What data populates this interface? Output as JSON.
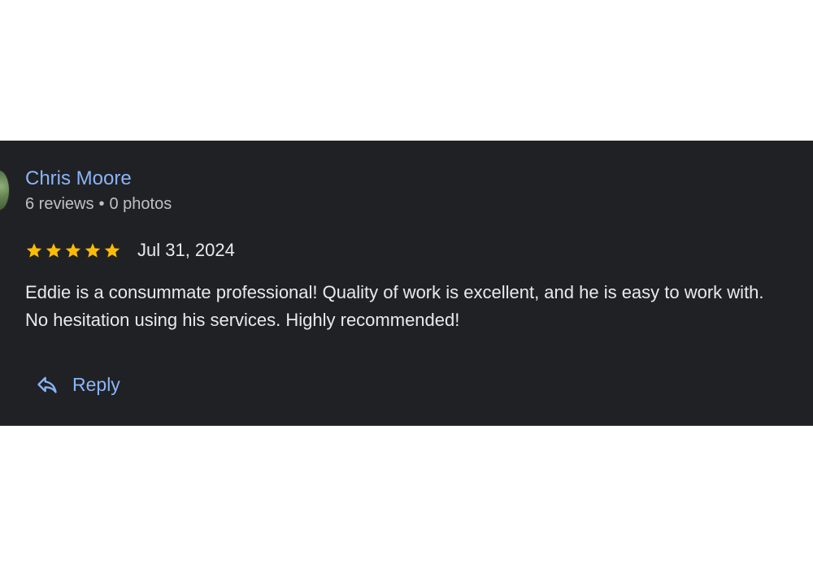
{
  "reviewer": {
    "name": "Chris Moore",
    "reviews_count": "6 reviews",
    "separator": "•",
    "photos_count": "0 photos"
  },
  "review": {
    "rating": 5,
    "rating_max": 5,
    "star_color": "#fbbc04",
    "date": "Jul 31, 2024",
    "text_line_1": "Eddie is a consummate professional! Quality of work is excellent, and he is easy to work with.",
    "text_line_2": "No hesitation using his services. Highly recommended!"
  },
  "actions": {
    "reply_icon": "reply-arrow-icon",
    "reply_label": "Reply"
  },
  "colors": {
    "card_background": "#202124",
    "accent": "#8ab4f8",
    "primary_text": "#e8eaed",
    "secondary_text": "#bdc1c6"
  }
}
